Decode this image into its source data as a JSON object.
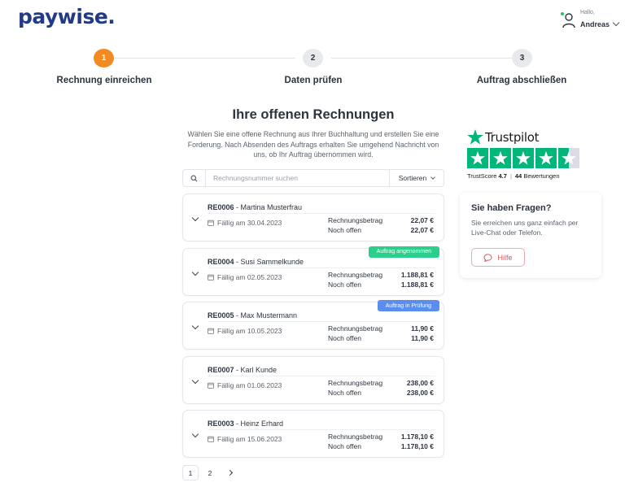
{
  "brand": {
    "logo": "paywise."
  },
  "user": {
    "greeting": "Hallo,",
    "name": "Andreas"
  },
  "stepper": {
    "steps": [
      {
        "number": "1",
        "label": "Rechnung einreichen"
      },
      {
        "number": "2",
        "label": "Daten prüfen"
      },
      {
        "number": "3",
        "label": "Auftrag abschließen"
      }
    ]
  },
  "main": {
    "title": "Ihre offenen Rechnungen",
    "intro": "Wählen Sie eine offene Rechnung aus Ihrer Buchhaltung und erstellen Sie eine Forderung. Nach Absenden des Auftrags erhalten Sie umgehend Nachricht von uns, ob Ihr Auftrag übernommen wird."
  },
  "search": {
    "placeholder": "Rechnungsnummer suchen",
    "sort_label": "Sortieren"
  },
  "invoice_labels": {
    "amount": "Rechnungsbetrag",
    "open": "Noch offen"
  },
  "invoices": [
    {
      "number": "RE0006",
      "customer": " - Martina Musterfrau",
      "due": "Fällig am 30.04.2023",
      "amount": "22,07 €",
      "open": "22,07 €",
      "badge": ""
    },
    {
      "number": "RE0004",
      "customer": " - Susi Sammelkunde",
      "due": "Fällig am 02.05.2023",
      "amount": "1.188,81 €",
      "open": "1.188,81 €",
      "badge": "Auftrag angenommen"
    },
    {
      "number": "RE0005",
      "customer": " - Max Mustermann",
      "due": "Fällig am 10.05.2023",
      "amount": "11,90 €",
      "open": "11,90 €",
      "badge": "Auftrag in Prüfung"
    },
    {
      "number": "RE0007",
      "customer": " - Karl Kunde",
      "due": "Fällig am 01.06.2023",
      "amount": "238,00 €",
      "open": "238,00 €",
      "badge": ""
    },
    {
      "number": "RE0003",
      "customer": " - Heinz Erhard",
      "due": "Fällig am 15.06.2023",
      "amount": "1.178,10 €",
      "open": "1.178,10 €",
      "badge": ""
    }
  ],
  "pagination": {
    "pages": [
      "1",
      "2"
    ],
    "current": "1"
  },
  "trustpilot": {
    "name": "Trustpilot",
    "score_label": "TrustScore",
    "score": "4.7",
    "reviews_count": "44",
    "reviews_label": "Bewertungen",
    "rating": 4.7,
    "brand_color": "#00b67a"
  },
  "help": {
    "title": "Sie haben Fragen?",
    "text": "Sie erreichen uns ganz einfach per Live-Chat oder Telefon.",
    "button": "Hilfe"
  },
  "colors": {
    "brand": "#233a87",
    "step_active": "#f28a22",
    "badge_accepted": "#2bcf8c",
    "badge_review": "#5b8def",
    "help_accent": "#e0535e"
  }
}
